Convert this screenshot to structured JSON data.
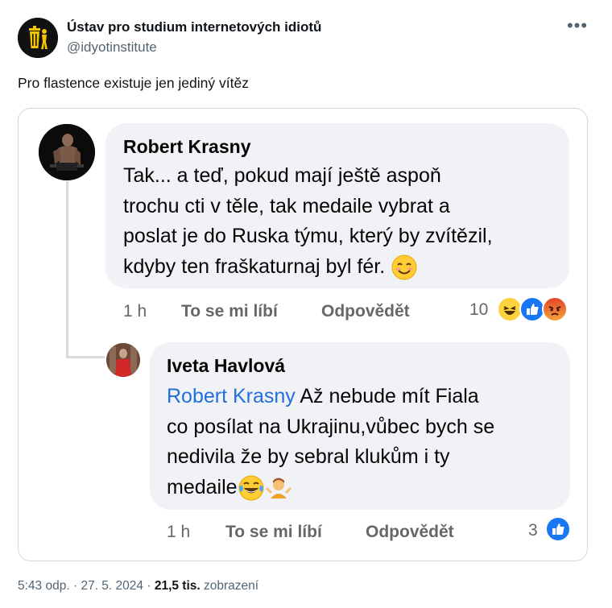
{
  "header": {
    "author_name": "Ústav pro studium internetových idiotů",
    "author_handle": "@idyotinstitute",
    "more_label": "•••"
  },
  "tweet": {
    "text": "Pro flastence existuje jen jediný vítěz"
  },
  "comments": [
    {
      "name": "Robert Krasny",
      "lines": [
        "Tak... a teď, pokud mají ještě aspoň",
        "trochu cti v těle, tak medaile vybrat a",
        "poslat je do Ruska týmu, který by zvítězil,",
        "kdyby ten fraškaturnaj byl fér."
      ],
      "time": "1 h",
      "like_label": "To se mi líbí",
      "reply_label": "Odpovědět",
      "reaction_count": "10",
      "reactions": [
        "haha-icon",
        "like-icon",
        "angry-icon"
      ]
    },
    {
      "name": "Iveta Havlová",
      "mention": "Robert Krasny",
      "lines": [
        "Až nebude mít Fiala",
        "co posílat na Ukrajinu,vůbec bych se",
        "nedivila že by sebral klukům i ty",
        "medaile"
      ],
      "time": "1 h",
      "like_label": "To se mi líbí",
      "reply_label": "Odpovědět",
      "reaction_count": "3",
      "reactions": [
        "like-icon"
      ]
    }
  ],
  "meta": {
    "time": "5:43 odp.",
    "sep1": "·",
    "date": "27. 5. 2024",
    "sep2": "·",
    "views": "21,5 tis.",
    "views_label": "zobrazení"
  }
}
